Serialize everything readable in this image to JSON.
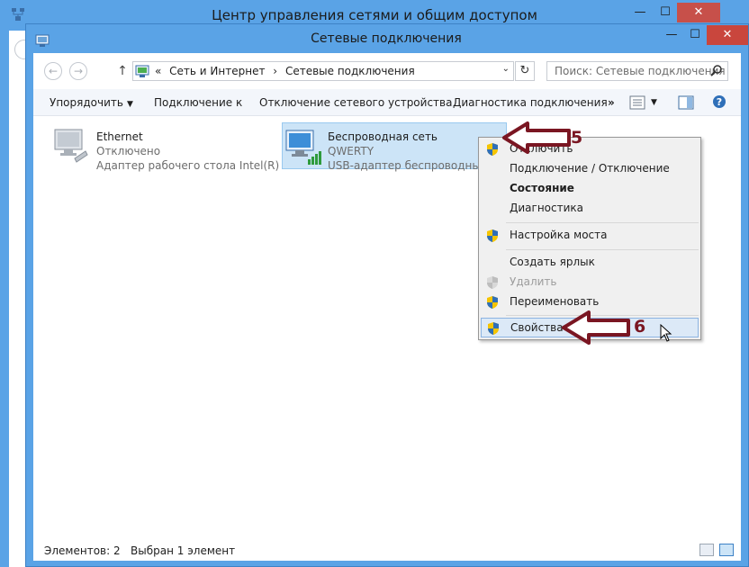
{
  "back_window": {
    "title": "Центр управления сетями и общим доступом",
    "minimize_glyph": "—",
    "maximize_glyph": "☐",
    "close_glyph": "✕"
  },
  "window": {
    "title": "Сетевые подключения",
    "minimize_glyph": "—",
    "maximize_glyph": "☐",
    "close_glyph": "✕"
  },
  "nav": {
    "back_glyph": "←",
    "forward_glyph": "→",
    "up_glyph": "↑",
    "address_prefix": "«",
    "breadcrumb": [
      "Сеть и Интернет",
      "›",
      "Сетевые подключения"
    ],
    "breadcrumb_sep": "›",
    "dropdown_glyph": "⌄",
    "refresh_glyph": "↻",
    "search_placeholder": "Поиск: Сетевые подключения"
  },
  "toolbar": {
    "organize": "Упорядочить",
    "organize_arrow": "▼",
    "connect_to": "Подключение к",
    "disable": "Отключение сетевого устройства",
    "diagnose": "Диагностика подключения",
    "more": "»",
    "view_arrow": "▼"
  },
  "connections": [
    {
      "name": "Ethernet",
      "status": "Отключено",
      "adapter": "Адаптер рабочего стола Intel(R) ..."
    },
    {
      "name": "Беспроводная сеть",
      "status": "QWERTY",
      "adapter": "USB-адаптер беспроводных се"
    }
  ],
  "context_menu": {
    "items": [
      {
        "label": "Отключить"
      },
      {
        "label": "Подключение / Отключение"
      },
      {
        "label": "Состояние"
      },
      {
        "label": "Диагностика"
      },
      {
        "label": "Настройка моста"
      },
      {
        "label": "Создать ярлык"
      },
      {
        "label": "Удалить"
      },
      {
        "label": "Переименовать"
      },
      {
        "label": "Свойства"
      }
    ]
  },
  "annotations": {
    "step5": "5",
    "step6": "6"
  },
  "status": {
    "items_count": "Элементов: 2",
    "selected": "Выбран 1 элемент"
  },
  "colors": {
    "accent": "#5aa3e6",
    "selection": "#cce4f7",
    "annotation": "#7a1622",
    "close": "#c9463d"
  }
}
